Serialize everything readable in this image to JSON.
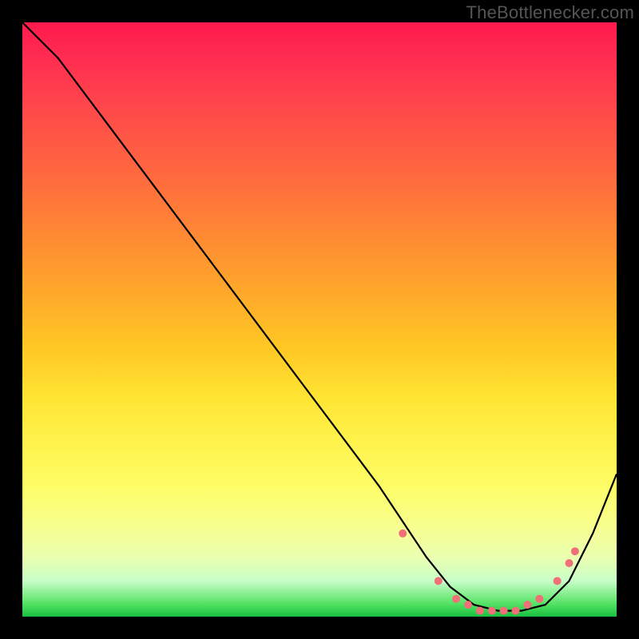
{
  "watermark": "TheBottlenecker.com",
  "chart_data": {
    "type": "line",
    "title": "",
    "xlabel": "",
    "ylabel": "",
    "xlim": [
      0,
      100
    ],
    "ylim": [
      0,
      100
    ],
    "grid": false,
    "series": [
      {
        "name": "curve",
        "x": [
          0,
          6,
          12,
          18,
          24,
          30,
          36,
          42,
          48,
          54,
          60,
          64,
          68,
          72,
          76,
          80,
          84,
          88,
          92,
          96,
          100
        ],
        "y": [
          100,
          94,
          86,
          78,
          70,
          62,
          54,
          46,
          38,
          30,
          22,
          16,
          10,
          5,
          2,
          1,
          1,
          2,
          6,
          14,
          24
        ],
        "color": "#000000"
      }
    ],
    "markers": {
      "name": "highlight-dots",
      "x": [
        64,
        70,
        73,
        75,
        77,
        79,
        81,
        83,
        85,
        87,
        90,
        92,
        93
      ],
      "y": [
        14,
        6,
        3,
        2,
        1,
        1,
        1,
        1,
        2,
        3,
        6,
        9,
        11
      ],
      "color": "#f07078",
      "radius": 5
    },
    "background_gradient": {
      "stops": [
        {
          "pos": 0.0,
          "color": "#ff1a4d"
        },
        {
          "pos": 0.5,
          "color": "#ffc824"
        },
        {
          "pos": 0.8,
          "color": "#fdfd66"
        },
        {
          "pos": 0.95,
          "color": "#c8ffc8"
        },
        {
          "pos": 1.0,
          "color": "#18c040"
        }
      ]
    }
  }
}
